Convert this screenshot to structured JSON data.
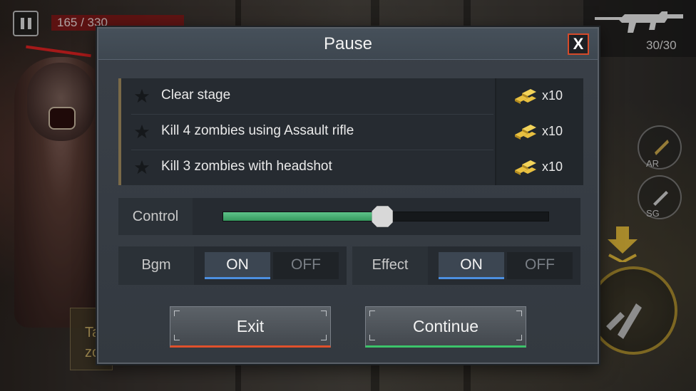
{
  "hud": {
    "hp_text": "165 / 330",
    "ammo_text": "30/30",
    "weapon_icon": "assault-rifle-icon",
    "side_buttons": [
      {
        "label": "AR",
        "icon": "bullet-icon"
      },
      {
        "label": "SG",
        "icon": "knife-icon"
      }
    ],
    "tip_text": "Ta zo"
  },
  "dialog": {
    "title": "Pause",
    "close_label": "X",
    "missions": [
      {
        "text": "Clear stage",
        "reward": "x10"
      },
      {
        "text": "Kill 4 zombies using Assault rifle",
        "reward": "x10"
      },
      {
        "text": "Kill 3 zombies with headshot",
        "reward": "x10"
      }
    ],
    "control": {
      "label": "Control",
      "value": 0.49
    },
    "bgm": {
      "label": "Bgm",
      "on": "ON",
      "off": "OFF",
      "state": "ON"
    },
    "effect": {
      "label": "Effect",
      "on": "ON",
      "off": "OFF",
      "state": "ON"
    },
    "exit_label": "Exit",
    "continue_label": "Continue"
  },
  "colors": {
    "accent_on": "#4c8fe0",
    "slider_fill": "#3fb06c",
    "exit_accent": "#e0502c",
    "continue_accent": "#3cc46a",
    "close_border": "#d54a2a",
    "gold": "#e8c040"
  }
}
